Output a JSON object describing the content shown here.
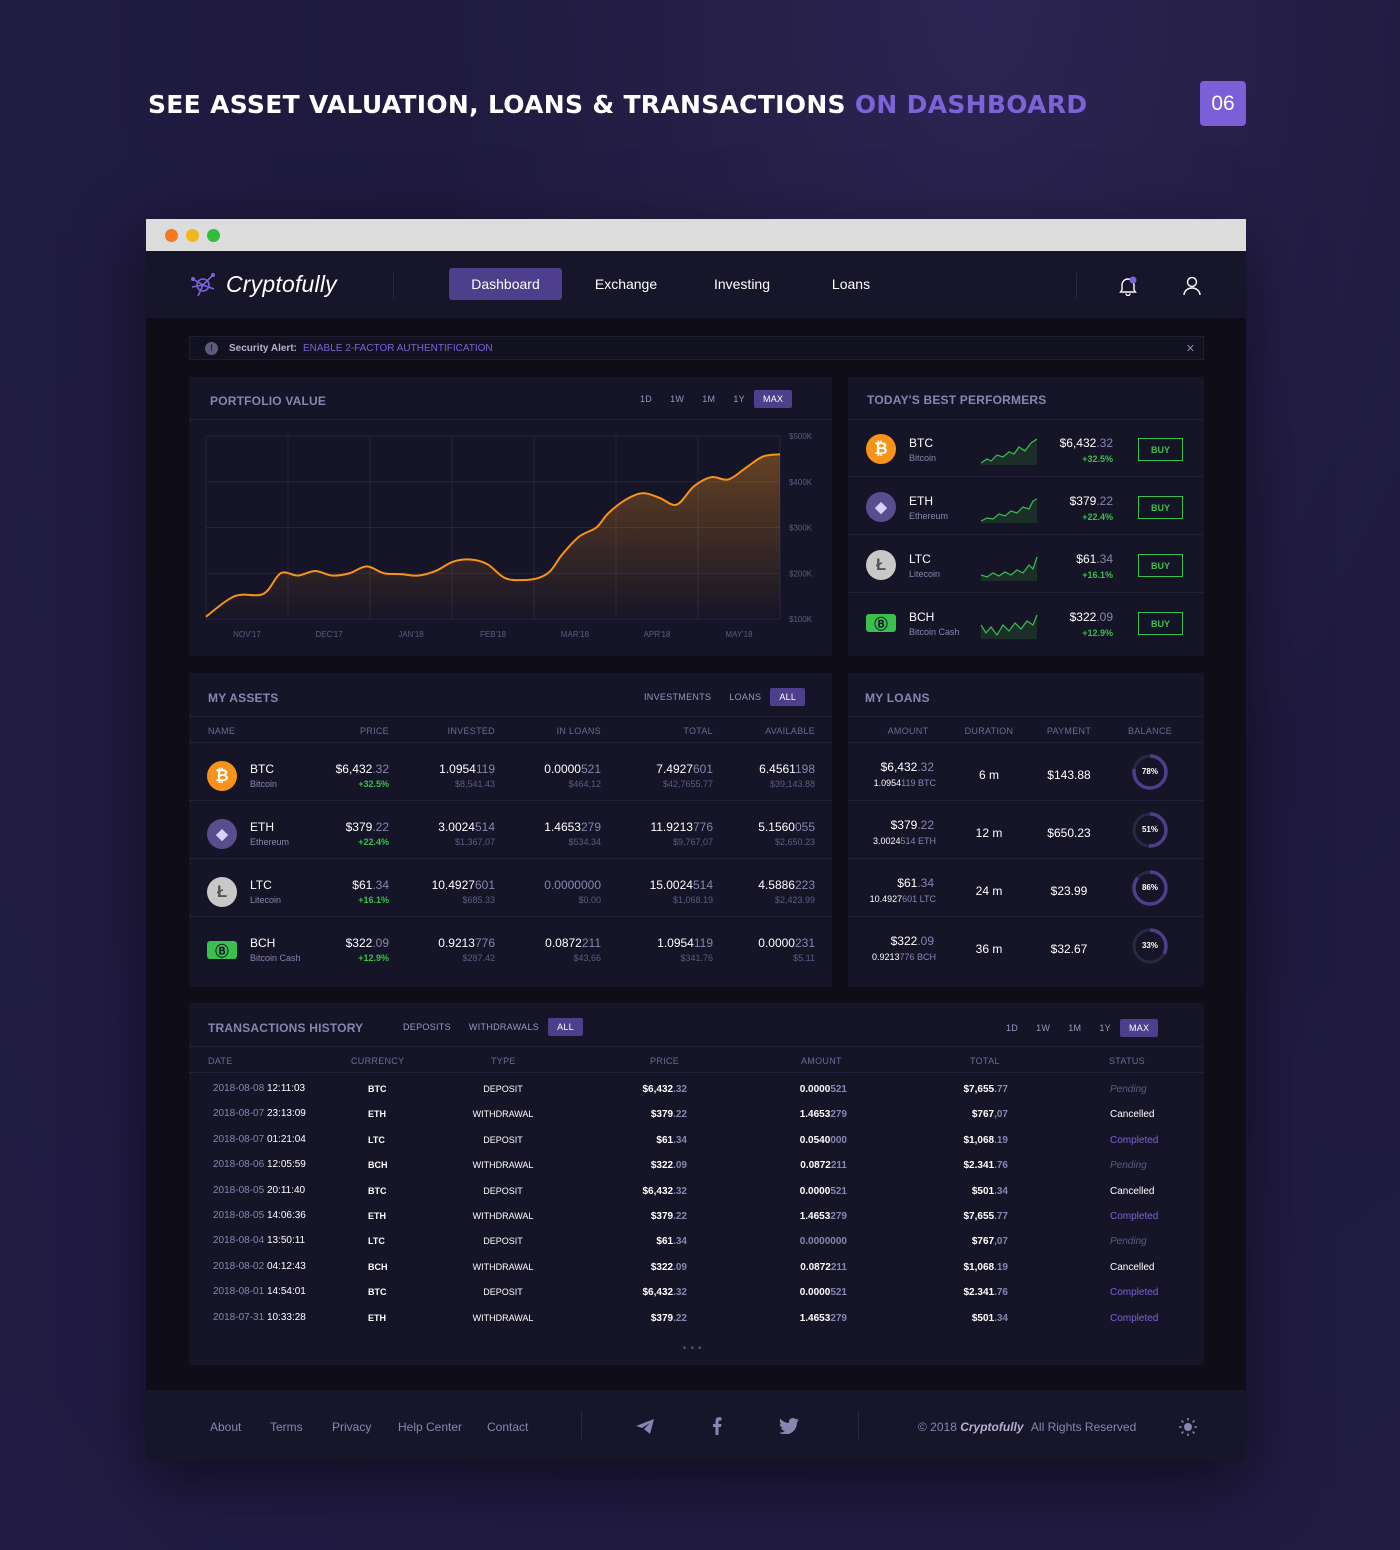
{
  "headline": {
    "main": "SEE ASSET VALUATION, LOANS & TRANSACTIONS",
    "accent": "ON DASHBOARD"
  },
  "page_number": "06",
  "brand": "Cryptofully",
  "nav": [
    "Dashboard",
    "Exchange",
    "Investing",
    "Loans"
  ],
  "colors": {
    "accent": "#4d3f8b",
    "orange": "#f7931a",
    "green": "#3bbf4e",
    "red": "#e2384d",
    "purple": "#7b63d8"
  },
  "alert": {
    "label": "Security Alert:",
    "link": "ENABLE 2-FACTOR AUTHENTIFICATION",
    "close": "✕"
  },
  "portfolio": {
    "title": "PORTFOLIO VALUE",
    "ranges": [
      "1D",
      "1W",
      "1M",
      "1Y",
      "MAX"
    ],
    "active_range": "MAX"
  },
  "chart_data": {
    "type": "area",
    "x_labels": [
      "NOV'17",
      "DEC'17",
      "JAN'18",
      "FEB'18",
      "MAR'18",
      "APR'18",
      "MAY'18"
    ],
    "y_labels": [
      "$500K",
      "$400K",
      "$300K",
      "$200K",
      "$100K"
    ],
    "ylim": [
      100000,
      500000
    ],
    "x": [
      0,
      0.05,
      0.1,
      0.13,
      0.16,
      0.19,
      0.22,
      0.25,
      0.28,
      0.31,
      0.34,
      0.37,
      0.4,
      0.43,
      0.46,
      0.49,
      0.52,
      0.55,
      0.58,
      0.6,
      0.62,
      0.65,
      0.68,
      0.7,
      0.73,
      0.76,
      0.79,
      0.82,
      0.85,
      0.88,
      0.91,
      0.94,
      0.97,
      1.0
    ],
    "values": [
      105000,
      150000,
      155000,
      200000,
      195000,
      205000,
      195000,
      200000,
      215000,
      200000,
      198000,
      195000,
      205000,
      225000,
      230000,
      220000,
      190000,
      185000,
      190000,
      205000,
      240000,
      280000,
      300000,
      330000,
      360000,
      375000,
      365000,
      350000,
      390000,
      410000,
      405000,
      430000,
      455000,
      460000
    ],
    "grid": true
  },
  "performers": {
    "title": "TODAY'S BEST PERFORMERS",
    "buy_label": "BUY",
    "items": [
      {
        "sym": "BTC",
        "name": "Bitcoin",
        "price_main": "$6,432",
        "price_dec": ".32",
        "change": "+32.5%"
      },
      {
        "sym": "ETH",
        "name": "Ethereum",
        "price_main": "$379",
        "price_dec": ".22",
        "change": "+22.4%"
      },
      {
        "sym": "LTC",
        "name": "Litecoin",
        "price_main": "$61",
        "price_dec": ".34",
        "change": "+16.1%"
      },
      {
        "sym": "BCH",
        "name": "Bitcoin Cash",
        "price_main": "$322",
        "price_dec": ".09",
        "change": "+12.9%"
      }
    ]
  },
  "assets": {
    "title": "MY ASSETS",
    "tabs": [
      "INVESTMENTS",
      "LOANS",
      "ALL"
    ],
    "columns": [
      "NAME",
      "PRICE",
      "INVESTED",
      "IN LOANS",
      "TOTAL",
      "AVAILABLE"
    ],
    "rows": [
      {
        "sym": "BTC",
        "name": "Bitcoin",
        "price": [
          "$6,432",
          ".32"
        ],
        "change": "+32.5%",
        "invested": [
          "1.0954",
          "119"
        ],
        "invested_usd": "$8,541.43",
        "loans": [
          "0.0000",
          "521"
        ],
        "loans_usd": "$464,12",
        "total": [
          "7.4927",
          "601"
        ],
        "total_usd": "$42,7655.77",
        "available": [
          "6.4561",
          "198"
        ],
        "available_usd": "$39,143.88"
      },
      {
        "sym": "ETH",
        "name": "Ethereum",
        "price": [
          "$379",
          ".22"
        ],
        "change": "+22.4%",
        "invested": [
          "3.0024",
          "514"
        ],
        "invested_usd": "$1,367,07",
        "loans": [
          "1.4653",
          "279"
        ],
        "loans_usd": "$534.34",
        "total": [
          "11.9213",
          "776"
        ],
        "total_usd": "$9,767,07",
        "available": [
          "5.1560",
          "055"
        ],
        "available_usd": "$2,650.23"
      },
      {
        "sym": "LTC",
        "name": "Litecoin",
        "price": [
          "$61",
          ".34"
        ],
        "change": "+16.1%",
        "invested": [
          "10.4927",
          "601"
        ],
        "invested_usd": "$685.33",
        "loans": [
          "",
          "0.0000000"
        ],
        "loans_usd": "$0.00",
        "total": [
          "15.0024",
          "514"
        ],
        "total_usd": "$1,068.19",
        "available": [
          "4.5886",
          "223"
        ],
        "available_usd": "$2,423.99"
      },
      {
        "sym": "BCH",
        "name": "Bitcoin Cash",
        "price": [
          "$322",
          ".09"
        ],
        "change": "+12.9%",
        "invested": [
          "0.9213",
          "776"
        ],
        "invested_usd": "$287.42",
        "loans": [
          "0.0872",
          "211"
        ],
        "loans_usd": "$43,66",
        "total": [
          "1.0954",
          "119"
        ],
        "total_usd": "$341.76",
        "available": [
          "0.0000",
          "231"
        ],
        "available_usd": "$5.11"
      }
    ]
  },
  "loans": {
    "title": "MY LOANS",
    "columns": [
      "AMOUNT",
      "DURATION",
      "PAYMENT",
      "BALANCE"
    ],
    "rows": [
      {
        "amount": [
          "$6,432",
          ".32"
        ],
        "crypto": [
          "1.0954",
          "119 BTC"
        ],
        "duration": "6 m",
        "payment": "$143.88",
        "balance": "78%",
        "balance_value": 0.78
      },
      {
        "amount": [
          "$379",
          ".22"
        ],
        "crypto": [
          "3.0024",
          "514 ETH"
        ],
        "duration": "12 m",
        "payment": "$650.23",
        "balance": "51%",
        "balance_value": 0.51
      },
      {
        "amount": [
          "$61",
          ".34"
        ],
        "crypto": [
          "10.4927",
          "601 LTC"
        ],
        "duration": "24 m",
        "payment": "$23.99",
        "balance": "86%",
        "balance_value": 0.86
      },
      {
        "amount": [
          "$322",
          ".09"
        ],
        "crypto": [
          "0.9213",
          "776 BCH"
        ],
        "duration": "36 m",
        "payment": "$32.67",
        "balance": "33%",
        "balance_value": 0.33
      }
    ]
  },
  "transactions": {
    "title": "TRANSACTIONS HISTORY",
    "type_tabs": [
      "DEPOSITS",
      "WITHDRAWALS",
      "ALL"
    ],
    "ranges": [
      "1D",
      "1W",
      "1M",
      "1Y",
      "MAX"
    ],
    "columns": [
      "DATE",
      "CURRENCY",
      "TYPE",
      "PRICE",
      "AMOUNT",
      "TOTAL",
      "STATUS"
    ],
    "more": "• • •",
    "rows": [
      {
        "date": "2018-08-08",
        "time": "12:11:03",
        "cur": "BTC",
        "type": "DEPOSIT",
        "price": [
          "$6,432",
          ".32"
        ],
        "amount": [
          "0.0000",
          "521"
        ],
        "total": [
          "$7,655",
          ".77"
        ],
        "status": "Pending"
      },
      {
        "date": "2018-08-07",
        "time": "23:13:09",
        "cur": "ETH",
        "type": "WITHDRAWAL",
        "price": [
          "$379",
          ".22"
        ],
        "amount": [
          "1.4653",
          "279"
        ],
        "total": [
          "$767",
          ",07"
        ],
        "status": "Cancelled"
      },
      {
        "date": "2018-08-07",
        "time": "01:21:04",
        "cur": "LTC",
        "type": "DEPOSIT",
        "price": [
          "$61",
          ".34"
        ],
        "amount": [
          "0.0540",
          "000"
        ],
        "total": [
          "$1,068",
          ".19"
        ],
        "status": "Completed"
      },
      {
        "date": "2018-08-06",
        "time": "12:05:59",
        "cur": "BCH",
        "type": "WITHDRAWAL",
        "price": [
          "$322",
          ".09"
        ],
        "amount": [
          "0.0872",
          "211"
        ],
        "total": [
          "$2.341",
          ".76"
        ],
        "status": "Pending"
      },
      {
        "date": "2018-08-05",
        "time": "20:11:40",
        "cur": "BTC",
        "type": "DEPOSIT",
        "price": [
          "$6,432",
          ".32"
        ],
        "amount": [
          "0.0000",
          "521"
        ],
        "total": [
          "$501",
          ".34"
        ],
        "status": "Cancelled"
      },
      {
        "date": "2018-08-05",
        "time": "14:06:36",
        "cur": "ETH",
        "type": "WITHDRAWAL",
        "price": [
          "$379",
          ".22"
        ],
        "amount": [
          "1.4653",
          "279"
        ],
        "total": [
          "$7,655",
          ".77"
        ],
        "status": "Completed"
      },
      {
        "date": "2018-08-04",
        "time": "13:50:11",
        "cur": "LTC",
        "type": "DEPOSIT",
        "price": [
          "$61",
          ".34"
        ],
        "amount": [
          "",
          "0.0000000"
        ],
        "total": [
          "$767",
          ",07"
        ],
        "status": "Pending"
      },
      {
        "date": "2018-08-02",
        "time": "04:12:43",
        "cur": "BCH",
        "type": "WITHDRAWAL",
        "price": [
          "$322",
          ".09"
        ],
        "amount": [
          "0.0872",
          "211"
        ],
        "total": [
          "$1,068",
          ".19"
        ],
        "status": "Cancelled"
      },
      {
        "date": "2018-08-01",
        "time": "14:54:01",
        "cur": "BTC",
        "type": "DEPOSIT",
        "price": [
          "$6,432",
          ".32"
        ],
        "amount": [
          "0.0000",
          "521"
        ],
        "total": [
          "$2.341",
          ".76"
        ],
        "status": "Completed"
      },
      {
        "date": "2018-07-31",
        "time": "10:33:28",
        "cur": "ETH",
        "type": "WITHDRAWAL",
        "price": [
          "$379",
          ".22"
        ],
        "amount": [
          "1.4653",
          "279"
        ],
        "total": [
          "$501",
          ".34"
        ],
        "status": "Completed"
      }
    ]
  },
  "footer": {
    "links": [
      "About",
      "Terms",
      "Privacy",
      "Help Center",
      "Contact"
    ],
    "social": [
      "telegram-icon",
      "facebook-icon",
      "twitter-icon"
    ],
    "copyright_prefix": "© 2018",
    "copyright_brand": "Cryptofully",
    "copyright_suffix": "All Rights Reserved"
  }
}
